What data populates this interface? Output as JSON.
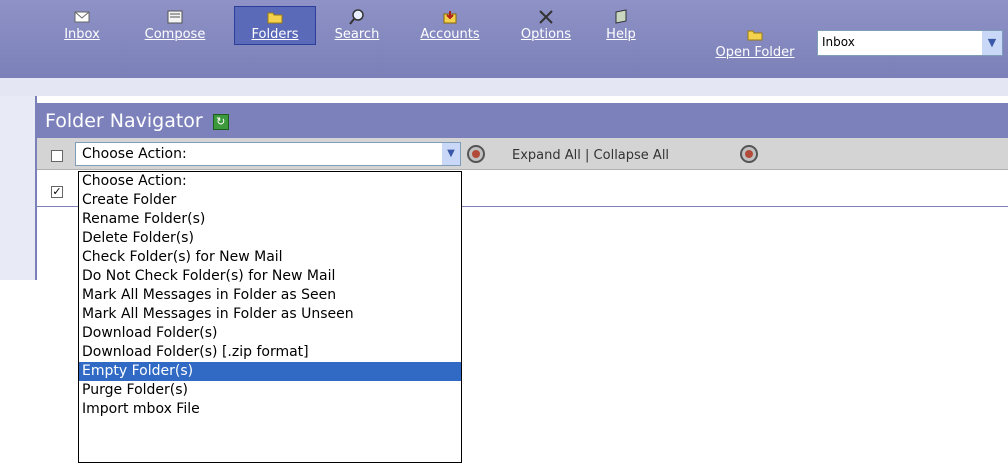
{
  "toolbar": {
    "items": [
      {
        "label": "Inbox",
        "icon": "envelope-icon"
      },
      {
        "label": "Compose",
        "icon": "compose-icon"
      },
      {
        "label": "Folders",
        "icon": "folder-icon"
      },
      {
        "label": "Search",
        "icon": "magnifier-icon"
      },
      {
        "label": "Accounts",
        "icon": "accounts-icon"
      },
      {
        "label": "Options",
        "icon": "tools-icon"
      },
      {
        "label": "Help",
        "icon": "help-book-icon"
      }
    ],
    "open_folder_label": "Open Folder",
    "folder_select_value": "Inbox"
  },
  "panel": {
    "title": "Folder Navigator",
    "action_select_value": "Choose Action:",
    "expand_all": "Expand All",
    "separator": "|",
    "collapse_all": "Collapse All"
  },
  "dropdown": {
    "options": [
      "Choose Action:",
      "Create Folder",
      "Rename Folder(s)",
      "Delete Folder(s)",
      "Check Folder(s) for New Mail",
      "Do Not Check Folder(s) for New Mail",
      "Mark All Messages in Folder as Seen",
      "Mark All Messages in Folder as Unseen",
      "Download Folder(s)",
      "Download Folder(s) [.zip format]",
      "Empty Folder(s)",
      "Purge Folder(s)",
      "Import mbox File"
    ],
    "selected": "Empty Folder(s)"
  },
  "colors": {
    "toolbar": "#7b80b8",
    "title_bar": "#7c81bc",
    "selection": "#316ac5"
  }
}
